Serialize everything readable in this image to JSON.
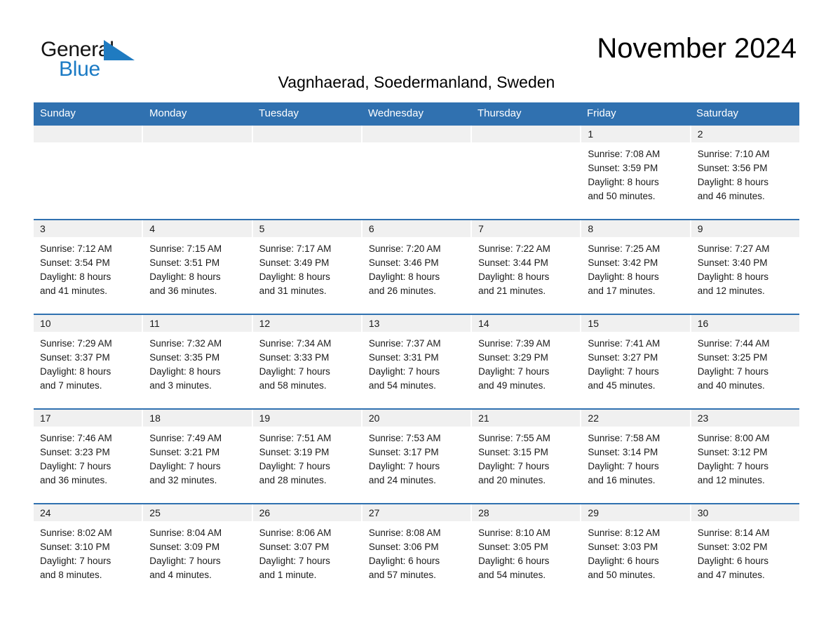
{
  "brand": {
    "name_part1": "General",
    "name_part2": "Blue",
    "accent_color": "#1a7ac4",
    "header_color": "#3071b0"
  },
  "header": {
    "month_title": "November 2024",
    "location": "Vagnhaerad, Soedermanland, Sweden"
  },
  "weekdays": [
    "Sunday",
    "Monday",
    "Tuesday",
    "Wednesday",
    "Thursday",
    "Friday",
    "Saturday"
  ],
  "weeks": [
    [
      {
        "day": "",
        "empty": true
      },
      {
        "day": "",
        "empty": true
      },
      {
        "day": "",
        "empty": true
      },
      {
        "day": "",
        "empty": true
      },
      {
        "day": "",
        "empty": true
      },
      {
        "day": "1",
        "sunrise": "Sunrise: 7:08 AM",
        "sunset": "Sunset: 3:59 PM",
        "daylight1": "Daylight: 8 hours",
        "daylight2": "and 50 minutes."
      },
      {
        "day": "2",
        "sunrise": "Sunrise: 7:10 AM",
        "sunset": "Sunset: 3:56 PM",
        "daylight1": "Daylight: 8 hours",
        "daylight2": "and 46 minutes."
      }
    ],
    [
      {
        "day": "3",
        "sunrise": "Sunrise: 7:12 AM",
        "sunset": "Sunset: 3:54 PM",
        "daylight1": "Daylight: 8 hours",
        "daylight2": "and 41 minutes."
      },
      {
        "day": "4",
        "sunrise": "Sunrise: 7:15 AM",
        "sunset": "Sunset: 3:51 PM",
        "daylight1": "Daylight: 8 hours",
        "daylight2": "and 36 minutes."
      },
      {
        "day": "5",
        "sunrise": "Sunrise: 7:17 AM",
        "sunset": "Sunset: 3:49 PM",
        "daylight1": "Daylight: 8 hours",
        "daylight2": "and 31 minutes."
      },
      {
        "day": "6",
        "sunrise": "Sunrise: 7:20 AM",
        "sunset": "Sunset: 3:46 PM",
        "daylight1": "Daylight: 8 hours",
        "daylight2": "and 26 minutes."
      },
      {
        "day": "7",
        "sunrise": "Sunrise: 7:22 AM",
        "sunset": "Sunset: 3:44 PM",
        "daylight1": "Daylight: 8 hours",
        "daylight2": "and 21 minutes."
      },
      {
        "day": "8",
        "sunrise": "Sunrise: 7:25 AM",
        "sunset": "Sunset: 3:42 PM",
        "daylight1": "Daylight: 8 hours",
        "daylight2": "and 17 minutes."
      },
      {
        "day": "9",
        "sunrise": "Sunrise: 7:27 AM",
        "sunset": "Sunset: 3:40 PM",
        "daylight1": "Daylight: 8 hours",
        "daylight2": "and 12 minutes."
      }
    ],
    [
      {
        "day": "10",
        "sunrise": "Sunrise: 7:29 AM",
        "sunset": "Sunset: 3:37 PM",
        "daylight1": "Daylight: 8 hours",
        "daylight2": "and 7 minutes."
      },
      {
        "day": "11",
        "sunrise": "Sunrise: 7:32 AM",
        "sunset": "Sunset: 3:35 PM",
        "daylight1": "Daylight: 8 hours",
        "daylight2": "and 3 minutes."
      },
      {
        "day": "12",
        "sunrise": "Sunrise: 7:34 AM",
        "sunset": "Sunset: 3:33 PM",
        "daylight1": "Daylight: 7 hours",
        "daylight2": "and 58 minutes."
      },
      {
        "day": "13",
        "sunrise": "Sunrise: 7:37 AM",
        "sunset": "Sunset: 3:31 PM",
        "daylight1": "Daylight: 7 hours",
        "daylight2": "and 54 minutes."
      },
      {
        "day": "14",
        "sunrise": "Sunrise: 7:39 AM",
        "sunset": "Sunset: 3:29 PM",
        "daylight1": "Daylight: 7 hours",
        "daylight2": "and 49 minutes."
      },
      {
        "day": "15",
        "sunrise": "Sunrise: 7:41 AM",
        "sunset": "Sunset: 3:27 PM",
        "daylight1": "Daylight: 7 hours",
        "daylight2": "and 45 minutes."
      },
      {
        "day": "16",
        "sunrise": "Sunrise: 7:44 AM",
        "sunset": "Sunset: 3:25 PM",
        "daylight1": "Daylight: 7 hours",
        "daylight2": "and 40 minutes."
      }
    ],
    [
      {
        "day": "17",
        "sunrise": "Sunrise: 7:46 AM",
        "sunset": "Sunset: 3:23 PM",
        "daylight1": "Daylight: 7 hours",
        "daylight2": "and 36 minutes."
      },
      {
        "day": "18",
        "sunrise": "Sunrise: 7:49 AM",
        "sunset": "Sunset: 3:21 PM",
        "daylight1": "Daylight: 7 hours",
        "daylight2": "and 32 minutes."
      },
      {
        "day": "19",
        "sunrise": "Sunrise: 7:51 AM",
        "sunset": "Sunset: 3:19 PM",
        "daylight1": "Daylight: 7 hours",
        "daylight2": "and 28 minutes."
      },
      {
        "day": "20",
        "sunrise": "Sunrise: 7:53 AM",
        "sunset": "Sunset: 3:17 PM",
        "daylight1": "Daylight: 7 hours",
        "daylight2": "and 24 minutes."
      },
      {
        "day": "21",
        "sunrise": "Sunrise: 7:55 AM",
        "sunset": "Sunset: 3:15 PM",
        "daylight1": "Daylight: 7 hours",
        "daylight2": "and 20 minutes."
      },
      {
        "day": "22",
        "sunrise": "Sunrise: 7:58 AM",
        "sunset": "Sunset: 3:14 PM",
        "daylight1": "Daylight: 7 hours",
        "daylight2": "and 16 minutes."
      },
      {
        "day": "23",
        "sunrise": "Sunrise: 8:00 AM",
        "sunset": "Sunset: 3:12 PM",
        "daylight1": "Daylight: 7 hours",
        "daylight2": "and 12 minutes."
      }
    ],
    [
      {
        "day": "24",
        "sunrise": "Sunrise: 8:02 AM",
        "sunset": "Sunset: 3:10 PM",
        "daylight1": "Daylight: 7 hours",
        "daylight2": "and 8 minutes."
      },
      {
        "day": "25",
        "sunrise": "Sunrise: 8:04 AM",
        "sunset": "Sunset: 3:09 PM",
        "daylight1": "Daylight: 7 hours",
        "daylight2": "and 4 minutes."
      },
      {
        "day": "26",
        "sunrise": "Sunrise: 8:06 AM",
        "sunset": "Sunset: 3:07 PM",
        "daylight1": "Daylight: 7 hours",
        "daylight2": "and 1 minute."
      },
      {
        "day": "27",
        "sunrise": "Sunrise: 8:08 AM",
        "sunset": "Sunset: 3:06 PM",
        "daylight1": "Daylight: 6 hours",
        "daylight2": "and 57 minutes."
      },
      {
        "day": "28",
        "sunrise": "Sunrise: 8:10 AM",
        "sunset": "Sunset: 3:05 PM",
        "daylight1": "Daylight: 6 hours",
        "daylight2": "and 54 minutes."
      },
      {
        "day": "29",
        "sunrise": "Sunrise: 8:12 AM",
        "sunset": "Sunset: 3:03 PM",
        "daylight1": "Daylight: 6 hours",
        "daylight2": "and 50 minutes."
      },
      {
        "day": "30",
        "sunrise": "Sunrise: 8:14 AM",
        "sunset": "Sunset: 3:02 PM",
        "daylight1": "Daylight: 6 hours",
        "daylight2": "and 47 minutes."
      }
    ]
  ]
}
